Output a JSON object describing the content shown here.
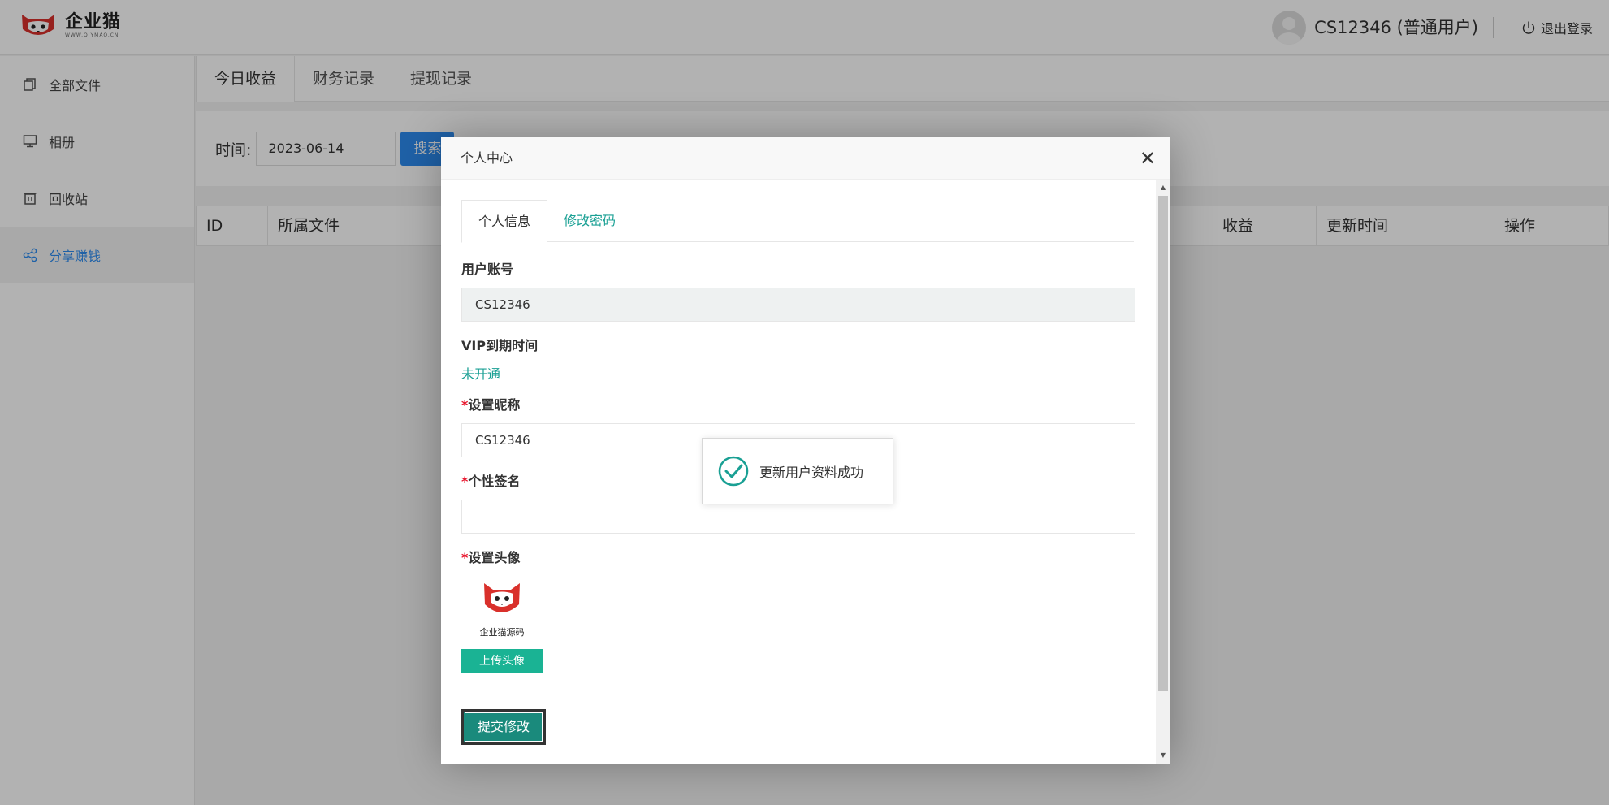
{
  "app": {
    "logo_text": "企业猫",
    "logo_url_text": "WWW.QIYMAO.CN"
  },
  "header": {
    "username": "CS12346 (普通用户)",
    "logout_label": "退出登录"
  },
  "sidebar": {
    "items": [
      {
        "label": "全部文件",
        "icon": "files-icon"
      },
      {
        "label": "相册",
        "icon": "monitor-icon"
      },
      {
        "label": "回收站",
        "icon": "trash-icon"
      },
      {
        "label": "分享赚钱",
        "icon": "share-icon"
      }
    ],
    "active_index": 3
  },
  "main": {
    "tabs": [
      {
        "label": "今日收益"
      },
      {
        "label": "财务记录"
      },
      {
        "label": "提现记录"
      }
    ],
    "filter": {
      "label": "时间:",
      "date_value": "2023-06-14",
      "search_label": "搜索"
    },
    "table": {
      "columns": [
        "ID",
        "所属文件",
        "收益",
        "更新时间",
        "操作"
      ]
    }
  },
  "modal": {
    "title": "个人中心",
    "close_glyph": "✕",
    "tabs": [
      {
        "label": "个人信息"
      },
      {
        "label": "修改密码"
      }
    ],
    "form": {
      "account_label": "用户账号",
      "account_value": "CS12346",
      "vip_label": "VIP到期时间",
      "vip_value": "未开通",
      "required_mark": "*",
      "nickname_label": "设置昵称",
      "nickname_value": "CS12346",
      "signature_label": "个性签名",
      "signature_value": "",
      "avatar_label": "设置头像",
      "avatar_caption": "企业猫源码",
      "upload_label": "上传头像",
      "submit_label": "提交修改"
    }
  },
  "toast": {
    "message": "更新用户资料成功"
  },
  "colors": {
    "accent": "#1aa094",
    "primary": "#2d8cf0",
    "required": "#e8142b",
    "brand_red": "#d9302b"
  }
}
